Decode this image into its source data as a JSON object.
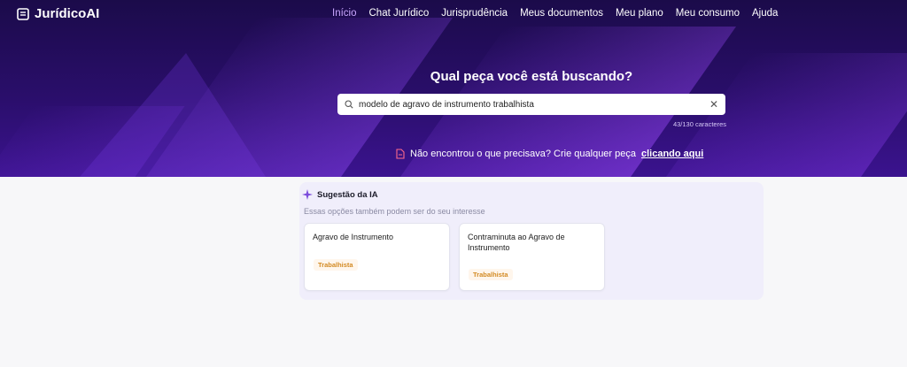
{
  "logo": {
    "name": "JurídicoAI"
  },
  "nav": [
    "Início",
    "Chat Jurídico",
    "Jurisprudência",
    "Meus documentos",
    "Meu plano",
    "Meu consumo",
    "Ajuda"
  ],
  "hero": {
    "title": "Qual peça você está buscando?",
    "search_value": "modelo de agravo de instrumento trabalhista",
    "char_count": "43/130 caracteres",
    "not_found_text": "Não encontrou o que precisava? Crie qualquer peça",
    "not_found_link": "clicando aqui"
  },
  "suggestions": {
    "title": "Sugestão da IA",
    "subtitle": "Essas opções também podem ser do seu interesse",
    "items": [
      {
        "title": "Agravo de Instrumento",
        "tag": "Trabalhista"
      },
      {
        "title": "Contraminuta ao Agravo de Instrumento",
        "tag": "Trabalhista"
      }
    ]
  },
  "colors": {
    "hero_dark": "#1b0b4a",
    "hero_light": "#3b138f",
    "accent": "#c9a6ff",
    "tag": "#d38a23"
  }
}
